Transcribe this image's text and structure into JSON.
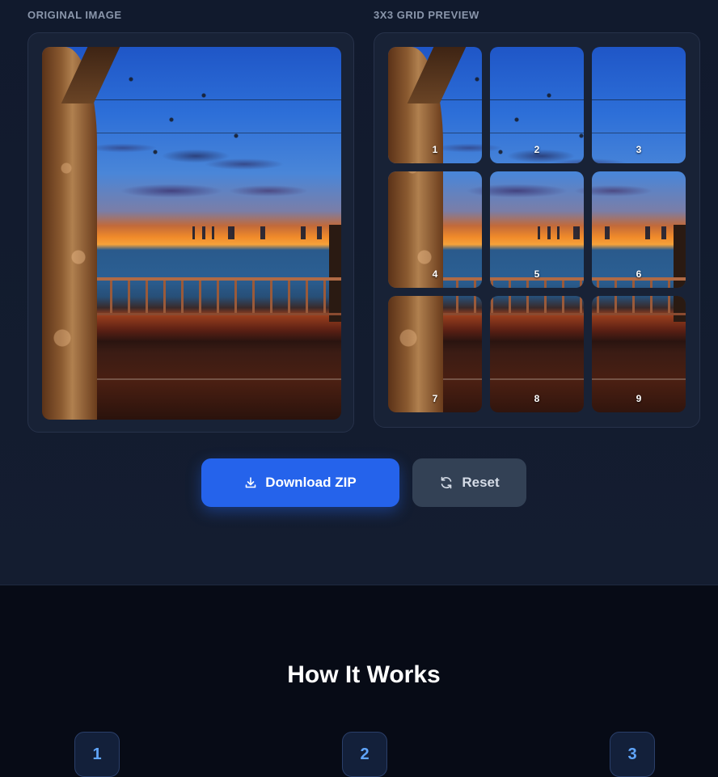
{
  "original_panel": {
    "label": "ORIGINAL IMAGE"
  },
  "grid_panel": {
    "label": "3X3 GRID PREVIEW",
    "tiles": [
      "1",
      "2",
      "3",
      "4",
      "5",
      "6",
      "7",
      "8",
      "9"
    ]
  },
  "actions": {
    "download_label": "Download ZIP",
    "reset_label": "Reset",
    "download_icon": "download-icon",
    "reset_icon": "refresh-icon"
  },
  "how_it_works": {
    "title": "How It Works",
    "steps": [
      "1",
      "2",
      "3"
    ]
  },
  "colors": {
    "accent": "#2563eb",
    "step_number": "#60a5fa",
    "background": "#070b16"
  }
}
